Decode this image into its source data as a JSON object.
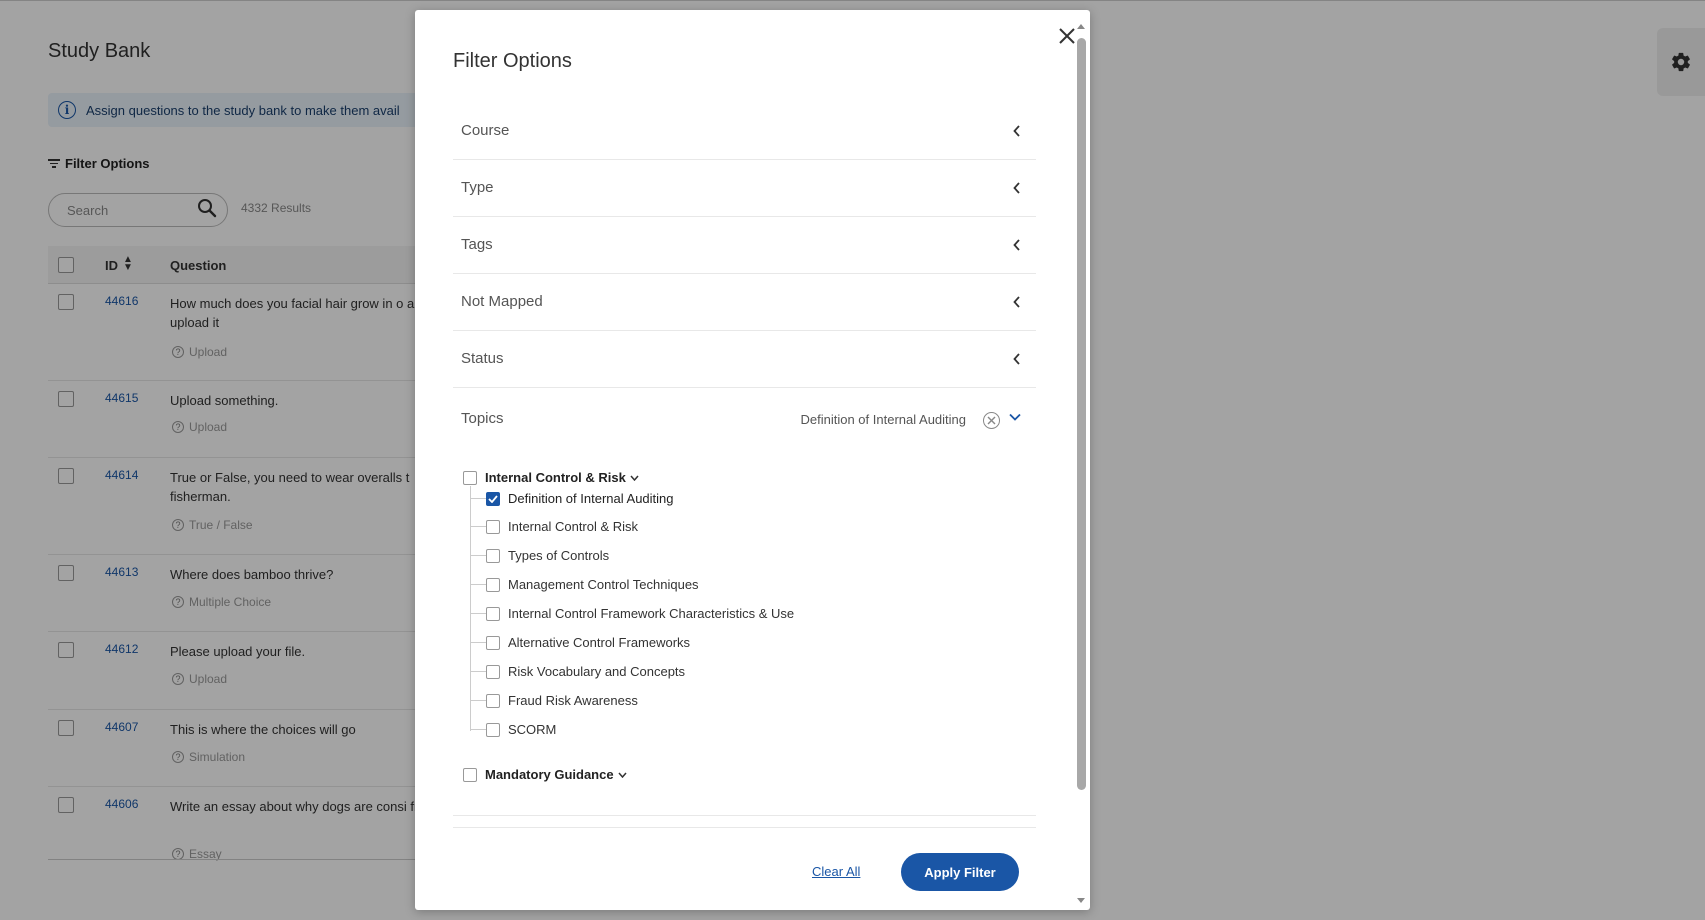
{
  "background": {
    "page_title": "Study Bank",
    "info_banner": "Assign questions to the study bank to make them avail",
    "filter_toggle_label": "Filter Options",
    "search": {
      "placeholder": "Search"
    },
    "results_count": "4332 Results",
    "table": {
      "headers": {
        "id": "ID",
        "question": "Question"
      },
      "rows": [
        {
          "id": "44616",
          "question": "How much does you facial hair grow in o and upload it",
          "type": "Upload"
        },
        {
          "id": "44615",
          "question": "Upload something.",
          "type": "Upload"
        },
        {
          "id": "44614",
          "question": "True or False, you need to wear overalls t fisherman.",
          "type": "True / False"
        },
        {
          "id": "44613",
          "question": "Where does bamboo thrive?",
          "type": "Multiple Choice"
        },
        {
          "id": "44612",
          "question": "Please upload your file.",
          "type": "Upload"
        },
        {
          "id": "44607",
          "question": "This is where the choices will go",
          "type": "Simulation"
        },
        {
          "id": "44606",
          "question": "Write an essay about why dogs are consi friend.\"",
          "type": "Essay"
        }
      ]
    },
    "settings_icon": "gear-icon"
  },
  "modal": {
    "title": "Filter Options",
    "close_icon": "close-icon",
    "sections": [
      {
        "label": "Course",
        "state": "collapsed"
      },
      {
        "label": "Type",
        "state": "collapsed"
      },
      {
        "label": "Tags",
        "state": "collapsed"
      },
      {
        "label": "Not Mapped",
        "state": "collapsed"
      },
      {
        "label": "Status",
        "state": "collapsed"
      }
    ],
    "topics": {
      "label": "Topics",
      "selected_value": "Definition of Internal Auditing",
      "groups": [
        {
          "label": "Internal Control & Risk",
          "checked": false,
          "expanded": true,
          "items": [
            {
              "label": "Definition of Internal Auditing",
              "checked": true
            },
            {
              "label": "Internal Control & Risk",
              "checked": false
            },
            {
              "label": "Types of Controls",
              "checked": false
            },
            {
              "label": "Management Control Techniques",
              "checked": false
            },
            {
              "label": "Internal Control Framework Characteristics & Use",
              "checked": false
            },
            {
              "label": "Alternative Control Frameworks",
              "checked": false
            },
            {
              "label": "Risk Vocabulary and Concepts",
              "checked": false
            },
            {
              "label": "Fraud Risk Awareness",
              "checked": false
            },
            {
              "label": "SCORM",
              "checked": false
            }
          ]
        },
        {
          "label": "Mandatory Guidance",
          "checked": false,
          "expanded": false
        }
      ]
    },
    "footer": {
      "clear_all": "Clear All",
      "apply": "Apply Filter"
    }
  },
  "colors": {
    "accent": "#1a56a6",
    "overlay": "rgba(0,0,0,0.36)"
  }
}
